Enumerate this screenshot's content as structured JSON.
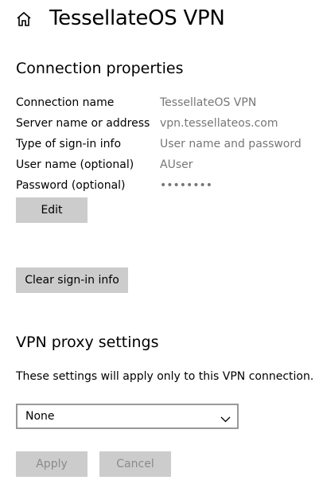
{
  "header": {
    "home_icon": "home-icon",
    "title": "TessellateOS VPN"
  },
  "connection": {
    "section_title": "Connection properties",
    "properties": [
      {
        "label": "Connection name",
        "value": "TessellateOS VPN"
      },
      {
        "label": "Server name or address",
        "value": "vpn.tessellateos.com"
      },
      {
        "label": "Type of sign-in info",
        "value": "User name and password"
      },
      {
        "label": "User name (optional)",
        "value": "AUser"
      },
      {
        "label": "Password (optional)",
        "value": "••••••••"
      }
    ],
    "edit_label": "Edit",
    "clear_label": "Clear sign-in info"
  },
  "proxy": {
    "section_title": "VPN proxy settings",
    "description": "These settings will apply only to this VPN connection.",
    "selected_option": "None",
    "dropdown_icon": "chevron-down-icon"
  },
  "footer": {
    "apply_label": "Apply",
    "cancel_label": "Cancel",
    "apply_enabled": false,
    "cancel_enabled": false
  },
  "colors": {
    "button_bg": "#cccccc",
    "value_text": "#767676",
    "disabled_text": "#8a8a8a",
    "dropdown_border": "#999999"
  }
}
